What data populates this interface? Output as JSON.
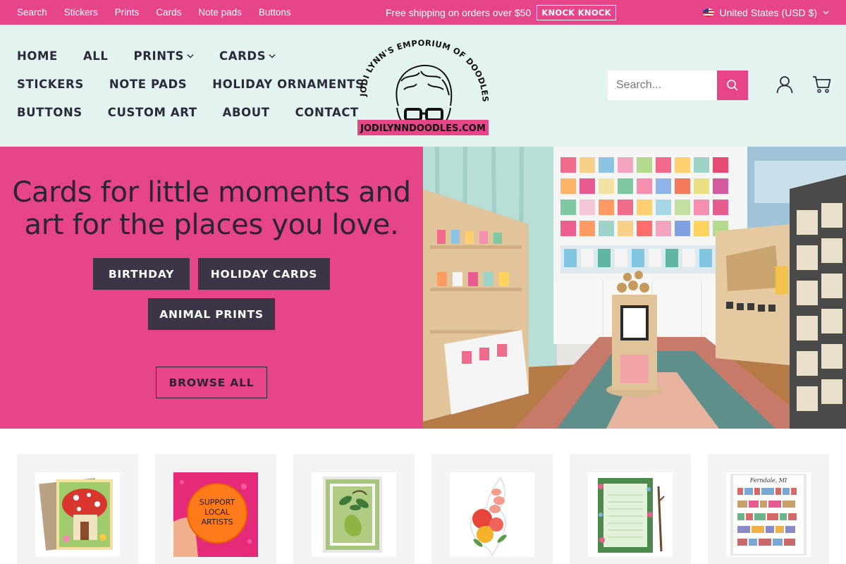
{
  "topbar": {
    "links": [
      "Search",
      "Stickers",
      "Prints",
      "Cards",
      "Note pads",
      "Buttons"
    ],
    "promo_text": "Free shipping on orders over $50",
    "promo_button": "KNOCK KNOCK",
    "country": "United States (USD $)"
  },
  "nav": {
    "row1": [
      "HOME",
      "ALL",
      "PRINTS",
      "CARDS"
    ],
    "row2": [
      "STICKERS",
      "NOTE PADS",
      "HOLIDAY ORNAMENTS"
    ],
    "row3": [
      "BUTTONS",
      "CUSTOM ART",
      "ABOUT",
      "CONTACT"
    ]
  },
  "logo": {
    "arc_text": "JODI LYNN'S EMPORIUM OF DOODLES",
    "banner_text": "JODILYNNDOODLES.COM"
  },
  "search": {
    "placeholder": "Search..."
  },
  "hero": {
    "title_line1": "Cards for little moments and",
    "title_line2": "art for the places you love.",
    "buttons": [
      "BIRTHDAY",
      "HOLIDAY CARDS",
      "ANIMAL PRINTS"
    ],
    "browse": "BROWSE ALL"
  },
  "products": {
    "button_text": "SUPPORT LOCAL ARTISTS",
    "map_title": "Ferndale, MI"
  },
  "colors": {
    "brand_pink": "#e6458a",
    "header_mint": "#e3f3ef",
    "dark_button": "#3d3448"
  }
}
